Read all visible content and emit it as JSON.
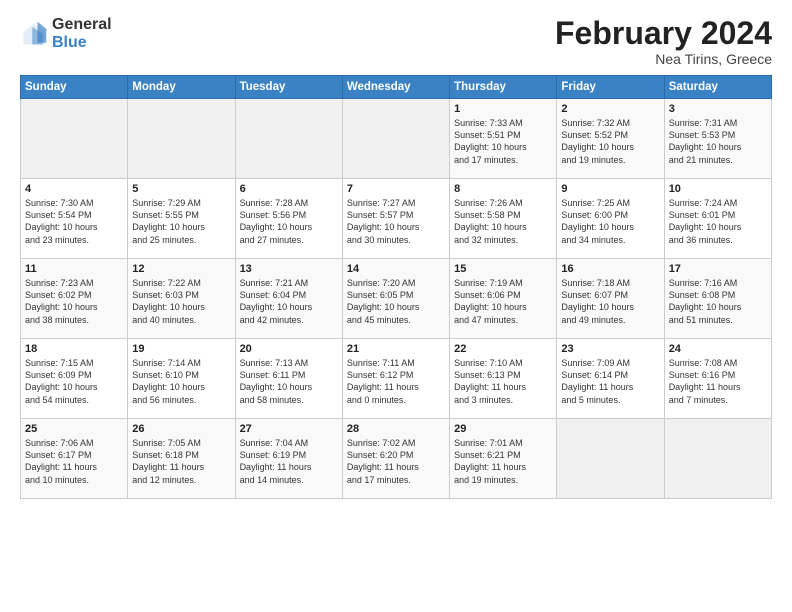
{
  "header": {
    "logo_general": "General",
    "logo_blue": "Blue",
    "month_title": "February 2024",
    "location": "Nea Tirins, Greece"
  },
  "columns": [
    "Sunday",
    "Monday",
    "Tuesday",
    "Wednesday",
    "Thursday",
    "Friday",
    "Saturday"
  ],
  "rows": [
    [
      {
        "day": "",
        "content": ""
      },
      {
        "day": "",
        "content": ""
      },
      {
        "day": "",
        "content": ""
      },
      {
        "day": "",
        "content": ""
      },
      {
        "day": "1",
        "content": "Sunrise: 7:33 AM\nSunset: 5:51 PM\nDaylight: 10 hours\nand 17 minutes."
      },
      {
        "day": "2",
        "content": "Sunrise: 7:32 AM\nSunset: 5:52 PM\nDaylight: 10 hours\nand 19 minutes."
      },
      {
        "day": "3",
        "content": "Sunrise: 7:31 AM\nSunset: 5:53 PM\nDaylight: 10 hours\nand 21 minutes."
      }
    ],
    [
      {
        "day": "4",
        "content": "Sunrise: 7:30 AM\nSunset: 5:54 PM\nDaylight: 10 hours\nand 23 minutes."
      },
      {
        "day": "5",
        "content": "Sunrise: 7:29 AM\nSunset: 5:55 PM\nDaylight: 10 hours\nand 25 minutes."
      },
      {
        "day": "6",
        "content": "Sunrise: 7:28 AM\nSunset: 5:56 PM\nDaylight: 10 hours\nand 27 minutes."
      },
      {
        "day": "7",
        "content": "Sunrise: 7:27 AM\nSunset: 5:57 PM\nDaylight: 10 hours\nand 30 minutes."
      },
      {
        "day": "8",
        "content": "Sunrise: 7:26 AM\nSunset: 5:58 PM\nDaylight: 10 hours\nand 32 minutes."
      },
      {
        "day": "9",
        "content": "Sunrise: 7:25 AM\nSunset: 6:00 PM\nDaylight: 10 hours\nand 34 minutes."
      },
      {
        "day": "10",
        "content": "Sunrise: 7:24 AM\nSunset: 6:01 PM\nDaylight: 10 hours\nand 36 minutes."
      }
    ],
    [
      {
        "day": "11",
        "content": "Sunrise: 7:23 AM\nSunset: 6:02 PM\nDaylight: 10 hours\nand 38 minutes."
      },
      {
        "day": "12",
        "content": "Sunrise: 7:22 AM\nSunset: 6:03 PM\nDaylight: 10 hours\nand 40 minutes."
      },
      {
        "day": "13",
        "content": "Sunrise: 7:21 AM\nSunset: 6:04 PM\nDaylight: 10 hours\nand 42 minutes."
      },
      {
        "day": "14",
        "content": "Sunrise: 7:20 AM\nSunset: 6:05 PM\nDaylight: 10 hours\nand 45 minutes."
      },
      {
        "day": "15",
        "content": "Sunrise: 7:19 AM\nSunset: 6:06 PM\nDaylight: 10 hours\nand 47 minutes."
      },
      {
        "day": "16",
        "content": "Sunrise: 7:18 AM\nSunset: 6:07 PM\nDaylight: 10 hours\nand 49 minutes."
      },
      {
        "day": "17",
        "content": "Sunrise: 7:16 AM\nSunset: 6:08 PM\nDaylight: 10 hours\nand 51 minutes."
      }
    ],
    [
      {
        "day": "18",
        "content": "Sunrise: 7:15 AM\nSunset: 6:09 PM\nDaylight: 10 hours\nand 54 minutes."
      },
      {
        "day": "19",
        "content": "Sunrise: 7:14 AM\nSunset: 6:10 PM\nDaylight: 10 hours\nand 56 minutes."
      },
      {
        "day": "20",
        "content": "Sunrise: 7:13 AM\nSunset: 6:11 PM\nDaylight: 10 hours\nand 58 minutes."
      },
      {
        "day": "21",
        "content": "Sunrise: 7:11 AM\nSunset: 6:12 PM\nDaylight: 11 hours\nand 0 minutes."
      },
      {
        "day": "22",
        "content": "Sunrise: 7:10 AM\nSunset: 6:13 PM\nDaylight: 11 hours\nand 3 minutes."
      },
      {
        "day": "23",
        "content": "Sunrise: 7:09 AM\nSunset: 6:14 PM\nDaylight: 11 hours\nand 5 minutes."
      },
      {
        "day": "24",
        "content": "Sunrise: 7:08 AM\nSunset: 6:16 PM\nDaylight: 11 hours\nand 7 minutes."
      }
    ],
    [
      {
        "day": "25",
        "content": "Sunrise: 7:06 AM\nSunset: 6:17 PM\nDaylight: 11 hours\nand 10 minutes."
      },
      {
        "day": "26",
        "content": "Sunrise: 7:05 AM\nSunset: 6:18 PM\nDaylight: 11 hours\nand 12 minutes."
      },
      {
        "day": "27",
        "content": "Sunrise: 7:04 AM\nSunset: 6:19 PM\nDaylight: 11 hours\nand 14 minutes."
      },
      {
        "day": "28",
        "content": "Sunrise: 7:02 AM\nSunset: 6:20 PM\nDaylight: 11 hours\nand 17 minutes."
      },
      {
        "day": "29",
        "content": "Sunrise: 7:01 AM\nSunset: 6:21 PM\nDaylight: 11 hours\nand 19 minutes."
      },
      {
        "day": "",
        "content": ""
      },
      {
        "day": "",
        "content": ""
      }
    ]
  ]
}
